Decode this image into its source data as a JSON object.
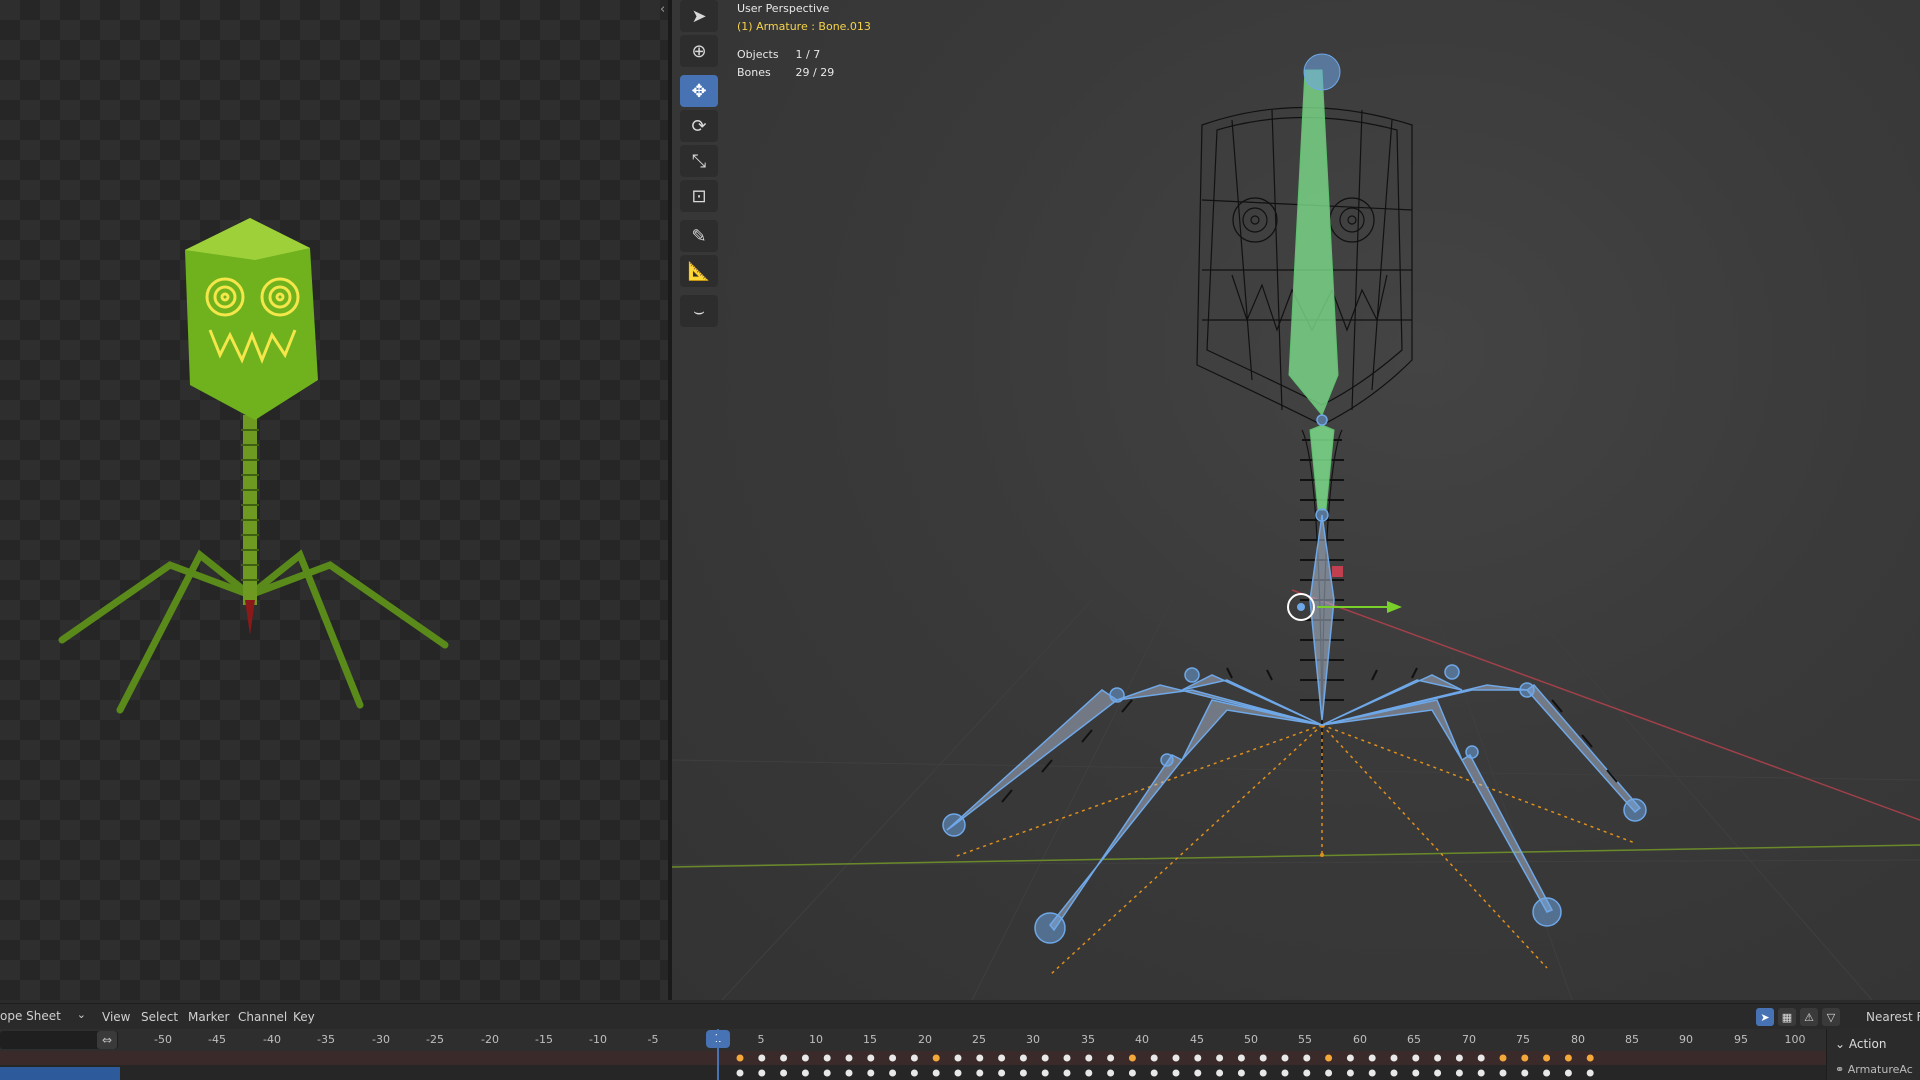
{
  "viewport": {
    "view_name": "User Perspective",
    "active_object": "(1) Armature : Bone.013",
    "stats": [
      {
        "label": "Objects",
        "value": "1 / 7"
      },
      {
        "label": "Bones",
        "value": "29 / 29"
      }
    ]
  },
  "toolbar": {
    "tools": [
      {
        "name": "select-box-tool",
        "icon": "cursor-icon",
        "glyph": "➤",
        "active": false
      },
      {
        "name": "cursor-tool",
        "icon": "crosshair-icon",
        "glyph": "⊕",
        "active": false
      },
      {
        "name": "move-tool",
        "icon": "move-arrows-icon",
        "glyph": "✥",
        "active": true
      },
      {
        "name": "rotate-tool",
        "icon": "rotate-icon",
        "glyph": "⟳",
        "active": false
      },
      {
        "name": "scale-tool",
        "icon": "scale-icon",
        "glyph": "⤡",
        "active": false
      },
      {
        "name": "transform-tool",
        "icon": "transform-icon",
        "glyph": "⊡",
        "active": false
      },
      {
        "name": "annotate-tool",
        "icon": "pencil-icon",
        "glyph": "✎",
        "active": false
      },
      {
        "name": "measure-tool",
        "icon": "ruler-icon",
        "glyph": "📐",
        "active": false
      },
      {
        "name": "curve-tool",
        "icon": "curve-icon",
        "glyph": "⌣",
        "active": false
      }
    ]
  },
  "dopesheet": {
    "mode_label": "ope Sheet",
    "menus": [
      "View",
      "Select",
      "Marker",
      "Channel",
      "Key"
    ],
    "snap_label": "Nearest Fr",
    "current_frame": "1",
    "ticks": [
      "-50",
      "-45",
      "-40",
      "-35",
      "-30",
      "-25",
      "-20",
      "-15",
      "-10",
      "-5",
      "5",
      "10",
      "15",
      "20",
      "25",
      "30",
      "35",
      "40",
      "45",
      "50",
      "55",
      "60",
      "65",
      "70",
      "75",
      "80",
      "85",
      "90",
      "95",
      "100"
    ],
    "sidebar_section": "Action",
    "sidebar_item": "ArmatureAc"
  },
  "colors": {
    "accent": "#4772b3",
    "bone_blue": "#6fa8e8",
    "bone_green": "#7ddc8a",
    "wire_black": "#111111",
    "x_axis": "#b0404a",
    "y_axis": "#7a9a2a",
    "keyframe_orange": "#f5a83a"
  }
}
